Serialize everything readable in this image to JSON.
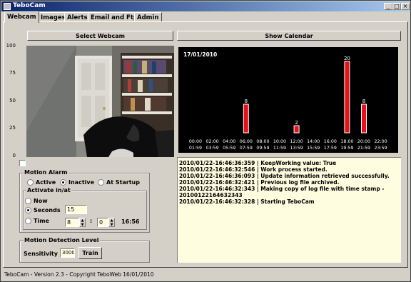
{
  "window": {
    "title": "TeboCam"
  },
  "tabs": [
    {
      "label": "Webcam",
      "active": true
    },
    {
      "label": "Images",
      "active": false
    },
    {
      "label": "Alerts",
      "active": false
    },
    {
      "label": "Email and Ftp",
      "active": false
    },
    {
      "label": "Admin",
      "active": false
    }
  ],
  "buttons": {
    "select_webcam": "Select Webcam",
    "show_calendar": "Show Calendar",
    "train": "Train"
  },
  "scale_ticks": [
    "100",
    "75",
    "50",
    "25",
    "0"
  ],
  "chart_data": {
    "type": "bar",
    "title": "17/01/2010",
    "categories": [
      "00:00 01:59",
      "02:00 03:59",
      "04:00 05:59",
      "06:00 07:59",
      "08:00 09:59",
      "10:00 11:59",
      "12:00 13:59",
      "14:00 15:59",
      "16:00 17:59",
      "18:00 19:59",
      "20:00 21:59",
      "22:00 23:59"
    ],
    "category_top": [
      "00:00",
      "02:00",
      "04:00",
      "06:00",
      "08:00",
      "10:00",
      "12:00",
      "14:00",
      "16:00",
      "18:00",
      "20:00",
      "22:00"
    ],
    "category_bottom": [
      "01:59",
      "03:59",
      "05:59",
      "07:59",
      "09:59",
      "11:59",
      "13:59",
      "15:59",
      "17:59",
      "19:59",
      "21:59",
      "23:59"
    ],
    "values": [
      0,
      0,
      0,
      8,
      0,
      0,
      2,
      0,
      0,
      20,
      8,
      0
    ],
    "ylim": [
      0,
      20
    ],
    "bar_color": "#e8101a"
  },
  "log_lines": [
    "2010/01/22-16:46:36:359 | KeepWorking value: True",
    "2010/01/22-16:46:32:546 | Work process started.",
    "2010/01/22-16:46:36:093 | Update information retrieved successfully.",
    "2010/01/22-16:46:32:421 | Previous log file archived.",
    "2010/01/22-16:46:32:343 | Making copy of log file with time stamp -",
    "20100122164632343",
    "2010/01/22-16:46:32:328 | Starting TeboCam"
  ],
  "motion_alarm": {
    "title": "Motion Alarm",
    "options": [
      "Active",
      "Inactive",
      "At Startup"
    ],
    "selected": "Inactive"
  },
  "activate": {
    "title": "Activate in/at",
    "now_label": "Now",
    "seconds_label": "Seconds",
    "seconds_value": "15",
    "time_label": "Time",
    "hour_value": "8",
    "minute_value": "0",
    "separator": ":",
    "time_display": "16:56",
    "selected": "Seconds"
  },
  "detection": {
    "title": "Motion Detection Level",
    "sensitivity_label": "Sensitivity",
    "sensitivity_value": "3000"
  },
  "status_bar": "TeboCam - Version 2.3 - Copyright TeboWeb 16/01/2010",
  "colors": {
    "title_start": "#0a246a",
    "title_end": "#a6caf0",
    "log_bg": "#fffde0",
    "chart_bg": "#000000"
  }
}
